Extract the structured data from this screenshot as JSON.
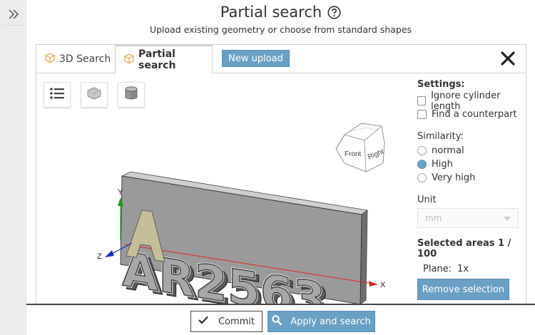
{
  "header": {
    "title": "Partial search",
    "subtitle": "Upload existing geometry or choose from standard shapes"
  },
  "tabs": [
    {
      "label": "3D Search",
      "icon": "cube-icon",
      "active": false
    },
    {
      "label": "Partial search",
      "icon": "cube-icon",
      "active": true
    }
  ],
  "new_upload_label": "New upload",
  "viewcube": {
    "front": "Front",
    "right": "Right"
  },
  "axes": {
    "x": "X",
    "y": "Y",
    "z": "Z"
  },
  "model_text": "AR2563",
  "settings": {
    "title": "Settings:",
    "options": [
      {
        "label": "Ignore cylinder length",
        "checked": false
      },
      {
        "label": "Find a counterpart",
        "checked": false
      }
    ],
    "similarity_label": "Similarity:",
    "similarity_options": [
      {
        "label": "normal",
        "selected": false
      },
      {
        "label": "High",
        "selected": true
      },
      {
        "label": "Very high",
        "selected": false
      }
    ],
    "unit_label": "Unit",
    "unit_value": "mm",
    "selected_areas": "Selected areas 1 / 100",
    "plane_label": "Plane:",
    "plane_value": "1x",
    "remove_label": "Remove selection"
  },
  "footer": {
    "commit_label": "Commit",
    "apply_label": "Apply and search"
  },
  "colors": {
    "accent": "#6aa0c3",
    "axis_x": "#e0261c",
    "axis_y": "#1a9a1a",
    "axis_z": "#1f2ecc"
  }
}
